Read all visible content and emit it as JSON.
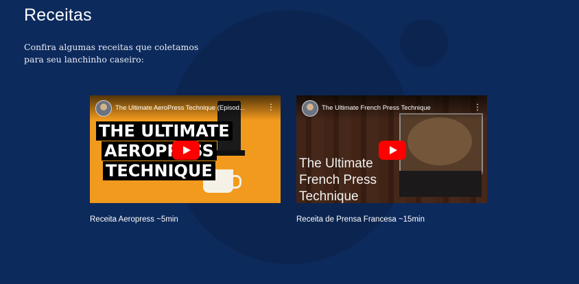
{
  "section": {
    "title": "Receitas",
    "subtitle": "Confira algumas receitas que coletamos para seu lanchinho caseiro:"
  },
  "videos": [
    {
      "title": "The Ultimate AeroPress Technique (Episod...",
      "overlay_lines": [
        "THE ULTIMATE",
        "AEROPRESS",
        "TECHNIQUE"
      ],
      "caption": "Receita Aeropress ~5min"
    },
    {
      "title": "The Ultimate French Press Technique",
      "overlay_lines": [
        "The Ultimate",
        "French Press",
        "Technique"
      ],
      "caption": "Receita de Prensa Francesa ~15min"
    }
  ],
  "icons": {
    "menu": "⋮"
  },
  "colors": {
    "background": "#0d2a5c",
    "play_button": "#ff0000",
    "thumbnail_1": "#f29a1d"
  }
}
